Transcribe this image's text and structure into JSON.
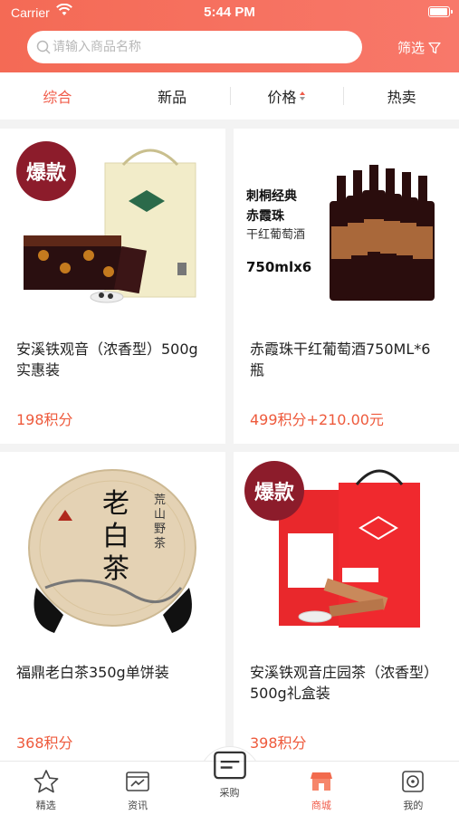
{
  "status_bar": {
    "carrier": "Carrier",
    "time": "5:44 PM"
  },
  "search": {
    "placeholder": "请输入商品名称"
  },
  "filter": {
    "label": "筛选"
  },
  "tabs": [
    {
      "label": "综合",
      "active": true
    },
    {
      "label": "新品",
      "active": false
    },
    {
      "label": "价格",
      "active": false
    },
    {
      "label": "热卖",
      "active": false
    }
  ],
  "products": [
    {
      "title": "安溪铁观音（浓香型）500g实惠装",
      "price": "198积分",
      "badge": "爆款"
    },
    {
      "title": "赤霞珠干红葡萄酒750ML*6瓶",
      "price": "499积分+210.00元",
      "image_text": {
        "line1": "刺桐经典",
        "line2": "赤霞珠",
        "line3": "干红葡萄酒",
        "line4": "750mlx6"
      }
    },
    {
      "title": "福鼎老白茶350g单饼装",
      "price": "368积分",
      "image_text": {
        "main": "老白茶",
        "side": "荒山野茶"
      }
    },
    {
      "title": "安溪铁观音庄园茶（浓香型）500g礼盒装",
      "price": "398积分",
      "badge": "爆款"
    }
  ],
  "tabbar": [
    {
      "label": "精选",
      "icon": "star-icon",
      "active": false
    },
    {
      "label": "资讯",
      "icon": "news-icon",
      "active": false
    },
    {
      "label": "采购",
      "icon": "purchase-icon",
      "active": false
    },
    {
      "label": "商城",
      "icon": "store-icon",
      "active": true
    },
    {
      "label": "我的",
      "icon": "profile-icon",
      "active": false
    }
  ],
  "colors": {
    "accent": "#f05c4a",
    "price": "#ee5a3c",
    "header": "#f46a55",
    "badge": "#8c1c2b"
  }
}
